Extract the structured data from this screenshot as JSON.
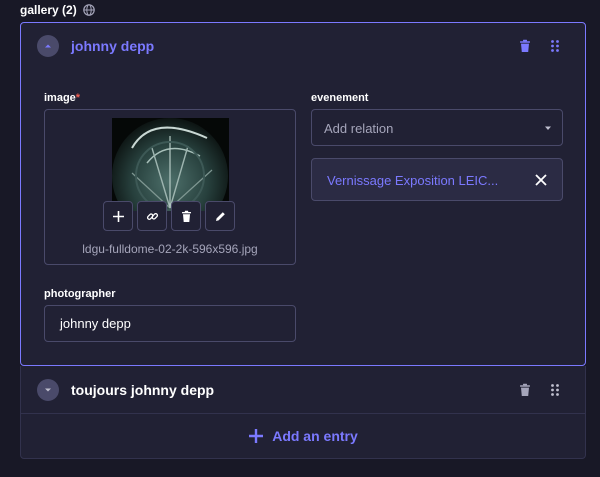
{
  "gallery": {
    "label": "gallery (2)",
    "entries": [
      {
        "title": "johnny depp",
        "expanded": true,
        "fields": {
          "image": {
            "label": "image",
            "required_mark": "*",
            "filename": "ldgu-fulldome-02-2k-596x596.jpg",
            "actions": [
              "add-icon",
              "link-icon",
              "trash-icon",
              "pencil-icon"
            ]
          },
          "photographer": {
            "label": "photographer",
            "value": "johnny depp"
          },
          "evenement": {
            "label": "evenement",
            "placeholder": "Add relation",
            "selected": "Vernissage Exposition LEIC..."
          }
        }
      },
      {
        "title": "toujours johnny depp",
        "expanded": false
      }
    ],
    "add_entry_label": "Add an entry"
  },
  "colors": {
    "accent": "#7b79ff",
    "background": "#181826",
    "panel": "#212134",
    "border": "#4a4a6a",
    "required": "#ee5e52"
  }
}
